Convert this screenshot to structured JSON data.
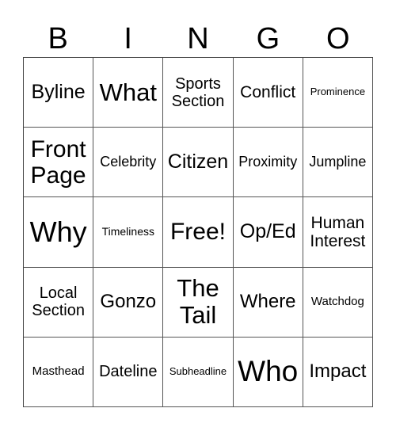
{
  "header": [
    "B",
    "I",
    "N",
    "G",
    "O"
  ],
  "cells": [
    {
      "text": "Byline",
      "size": "s25"
    },
    {
      "text": "What",
      "size": "s31"
    },
    {
      "text": "Sports\nSection",
      "size": "s20"
    },
    {
      "text": "Conflict",
      "size": "s21"
    },
    {
      "text": "Prominence",
      "size": "s13"
    },
    {
      "text": "Front\nPage",
      "size": "s30"
    },
    {
      "text": "Celebrity",
      "size": "s18"
    },
    {
      "text": "Citizen",
      "size": "s25"
    },
    {
      "text": "Proximity",
      "size": "s18"
    },
    {
      "text": "Jumpline",
      "size": "s18"
    },
    {
      "text": "Why",
      "size": "s36"
    },
    {
      "text": "Timeliness",
      "size": "s14"
    },
    {
      "text": "Free!",
      "size": "s30"
    },
    {
      "text": "Op/Ed",
      "size": "s25"
    },
    {
      "text": "Human\nInterest",
      "size": "s21"
    },
    {
      "text": "Local\nSection",
      "size": "s20"
    },
    {
      "text": "Gonzo",
      "size": "s24"
    },
    {
      "text": "The\nTail",
      "size": "s31"
    },
    {
      "text": "Where",
      "size": "s24"
    },
    {
      "text": "Watchdog",
      "size": "s15"
    },
    {
      "text": "Masthead",
      "size": "s15"
    },
    {
      "text": "Dateline",
      "size": "s20"
    },
    {
      "text": "Subheadline",
      "size": "s13"
    },
    {
      "text": "Who",
      "size": "s37"
    },
    {
      "text": "Impact",
      "size": "s24"
    }
  ]
}
